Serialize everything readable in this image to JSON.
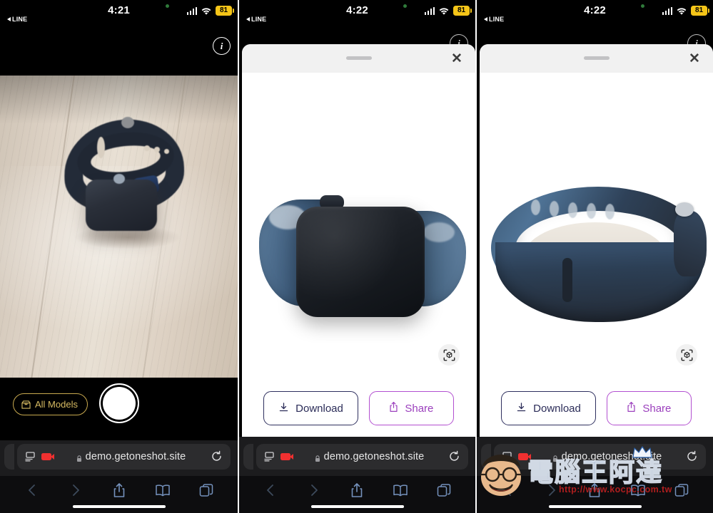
{
  "meta": {
    "app": "Safari",
    "device": "iPhone",
    "panel_count": 3
  },
  "panels": [
    {
      "id": "panel-capture",
      "status_bar": {
        "time": "4:21",
        "back_app": "LINE",
        "battery": "81",
        "signal_icon": "cellular-bars-icon",
        "wifi_icon": "wifi-icon",
        "battery_icon": "battery-icon",
        "recording_dot_icon": "green-recording-dot-icon"
      },
      "info_button_icon": "info-circle-icon",
      "camera": {
        "subject": "Apple Watch with dark blue sport band on light wood table",
        "all_models_label": "All Models",
        "all_models_icon": "box-icon",
        "shutter_icon": "shutter-button-icon",
        "accent_color": "#d8bc63"
      },
      "browser": {
        "url": "demo.getoneshot.site",
        "lock_icon": "lock-icon",
        "page_settings_icon": "aa-page-settings-icon",
        "recording_icon": "camera-recording-icon",
        "reload_icon": "reload-icon",
        "toolbar": [
          {
            "name": "back-button",
            "icon": "chevron-left-icon",
            "enabled": false
          },
          {
            "name": "forward-button",
            "icon": "chevron-right-icon",
            "enabled": false
          },
          {
            "name": "share-button",
            "icon": "share-icon",
            "enabled": true
          },
          {
            "name": "bookmarks-button",
            "icon": "book-icon",
            "enabled": true
          },
          {
            "name": "tabs-button",
            "icon": "tabs-icon",
            "enabled": true
          }
        ]
      }
    },
    {
      "id": "panel-model-front",
      "status_bar": {
        "time": "4:22",
        "back_app": "LINE",
        "battery": "81"
      },
      "info_button_icon": "info-circle-icon",
      "sheet": {
        "grabber_icon": "sheet-grabber-icon",
        "close_icon": "close-x-icon",
        "model_description": "3D scanned Apple Watch model, front-facing view, dark body with blue band",
        "ar_icon": "ar-cube-view-icon",
        "buttons": [
          {
            "label": "Download",
            "icon": "download-icon",
            "color": "#2b2c58"
          },
          {
            "label": "Share",
            "icon": "share-up-icon",
            "color": "#9b3fbd"
          }
        ]
      },
      "browser": {
        "url": "demo.getoneshot.site"
      }
    },
    {
      "id": "panel-model-rotated",
      "status_bar": {
        "time": "4:22",
        "back_app": "LINE",
        "battery": "81"
      },
      "info_button_icon": "info-circle-icon",
      "sheet": {
        "grabber_icon": "sheet-grabber-icon",
        "close_icon": "close-x-icon",
        "model_description": "3D scanned Apple Watch band, rotated top-down view showing blue strap interior",
        "ar_icon": "ar-cube-view-icon",
        "buttons": [
          {
            "label": "Download",
            "icon": "download-icon",
            "color": "#2b2c58"
          },
          {
            "label": "Share",
            "icon": "share-up-icon",
            "color": "#9b3fbd"
          }
        ]
      },
      "browser": {
        "url": "demo.getoneshot.site"
      }
    }
  ],
  "watermark": {
    "text": "電腦王阿達",
    "url": "http://www.kocpc.com.tw",
    "face_icon": "cartoon-face-logo",
    "crown_icon": "crown-icon",
    "text_color": "#1b4fa0",
    "url_color": "#c02020"
  }
}
